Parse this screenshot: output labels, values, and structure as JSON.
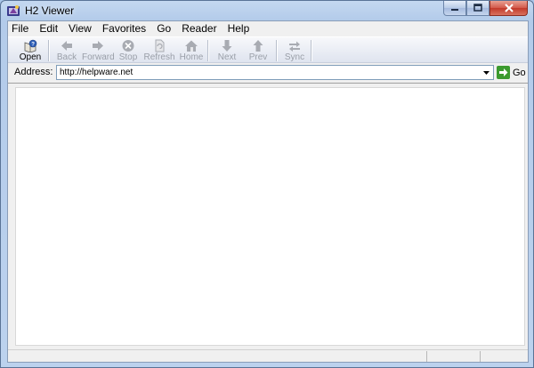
{
  "window": {
    "title": "H2 Viewer",
    "icon": "h2-viewer-app-icon"
  },
  "menu": [
    "File",
    "Edit",
    "View",
    "Favorites",
    "Go",
    "Reader",
    "Help"
  ],
  "toolbar": {
    "open": "Open",
    "back": "Back",
    "forward": "Forward",
    "stop": "Stop",
    "refresh": "Refresh",
    "home": "Home",
    "next": "Next",
    "prev": "Prev",
    "sync": "Sync"
  },
  "address": {
    "label": "Address:",
    "value": "http://helpware.net",
    "go": "Go"
  },
  "colors": {
    "accent": "#3b9a2f",
    "disabled_text": "#9a9fa8"
  }
}
